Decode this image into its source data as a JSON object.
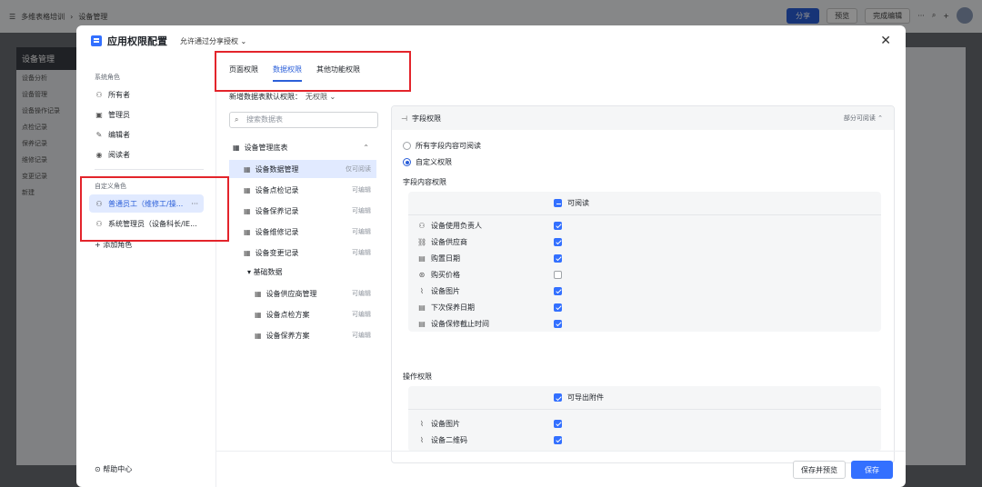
{
  "topbar": {
    "breadcrumb_1": "多维表格培训",
    "breadcrumb_2": "设备管理",
    "share": "分享",
    "preview": "预览",
    "finish": "完成编辑",
    "more": "···"
  },
  "bg_sidebar": {
    "title": "设备管理",
    "items": [
      "设备分析",
      "设备管理",
      "设备操作记录",
      "点检记录",
      "保养记录",
      "维修记录",
      "变更记录",
      "新建"
    ]
  },
  "modal": {
    "title": "应用权限配置",
    "auth_select": "允许通过分享授权",
    "close": "✕"
  },
  "roles": {
    "system_label": "系统角色",
    "system": [
      "所有者",
      "管理员",
      "编辑者",
      "阅读者"
    ],
    "custom_label": "自定义角色",
    "custom": [
      "普通员工（维修工/操...",
      "系统管理员（设备科长/IE..."
    ],
    "more": "···",
    "add": "添加角色",
    "help": "帮助中心"
  },
  "tabs": [
    "页面权限",
    "数据权限",
    "其他功能权限"
  ],
  "default_perm": {
    "label": "新增数据表默认权限：",
    "value": "无权限"
  },
  "search": {
    "placeholder": "搜索数据表"
  },
  "tree": {
    "root": "设备管理底表",
    "items": [
      {
        "name": "设备数据管理",
        "perm": "仅可阅读"
      },
      {
        "name": "设备点检记录",
        "perm": "可编辑"
      },
      {
        "name": "设备保养记录",
        "perm": "可编辑"
      },
      {
        "name": "设备维修记录",
        "perm": "可编辑"
      },
      {
        "name": "设备变更记录",
        "perm": "可编辑"
      }
    ],
    "group": "基础数据",
    "group_items": [
      {
        "name": "设备供应商管理",
        "perm": "可编辑"
      },
      {
        "name": "设备点检方案",
        "perm": "可编辑"
      },
      {
        "name": "设备保养方案",
        "perm": "可编辑"
      }
    ]
  },
  "field_perm": {
    "header": "字段权限",
    "status": "部分可阅读",
    "option_all": "所有字段内容可阅读",
    "option_custom": "自定义权限",
    "content_label": "字段内容权限",
    "col_label": "可阅读",
    "fields": [
      {
        "name": "设备使用负责人",
        "checked": true
      },
      {
        "name": "设备供应商",
        "checked": true
      },
      {
        "name": "购置日期",
        "checked": true
      },
      {
        "name": "购买价格",
        "checked": false
      },
      {
        "name": "设备图片",
        "checked": true
      },
      {
        "name": "下次保养日期",
        "checked": true
      },
      {
        "name": "设备保修截止时间",
        "checked": true
      }
    ],
    "op_label": "操作权限",
    "op_col_label": "可导出附件",
    "op_fields": [
      {
        "name": "设备图片",
        "checked": true
      },
      {
        "name": "设备二维码",
        "checked": true
      }
    ]
  },
  "footer": {
    "save_preview": "保存并预览",
    "save": "保存"
  }
}
